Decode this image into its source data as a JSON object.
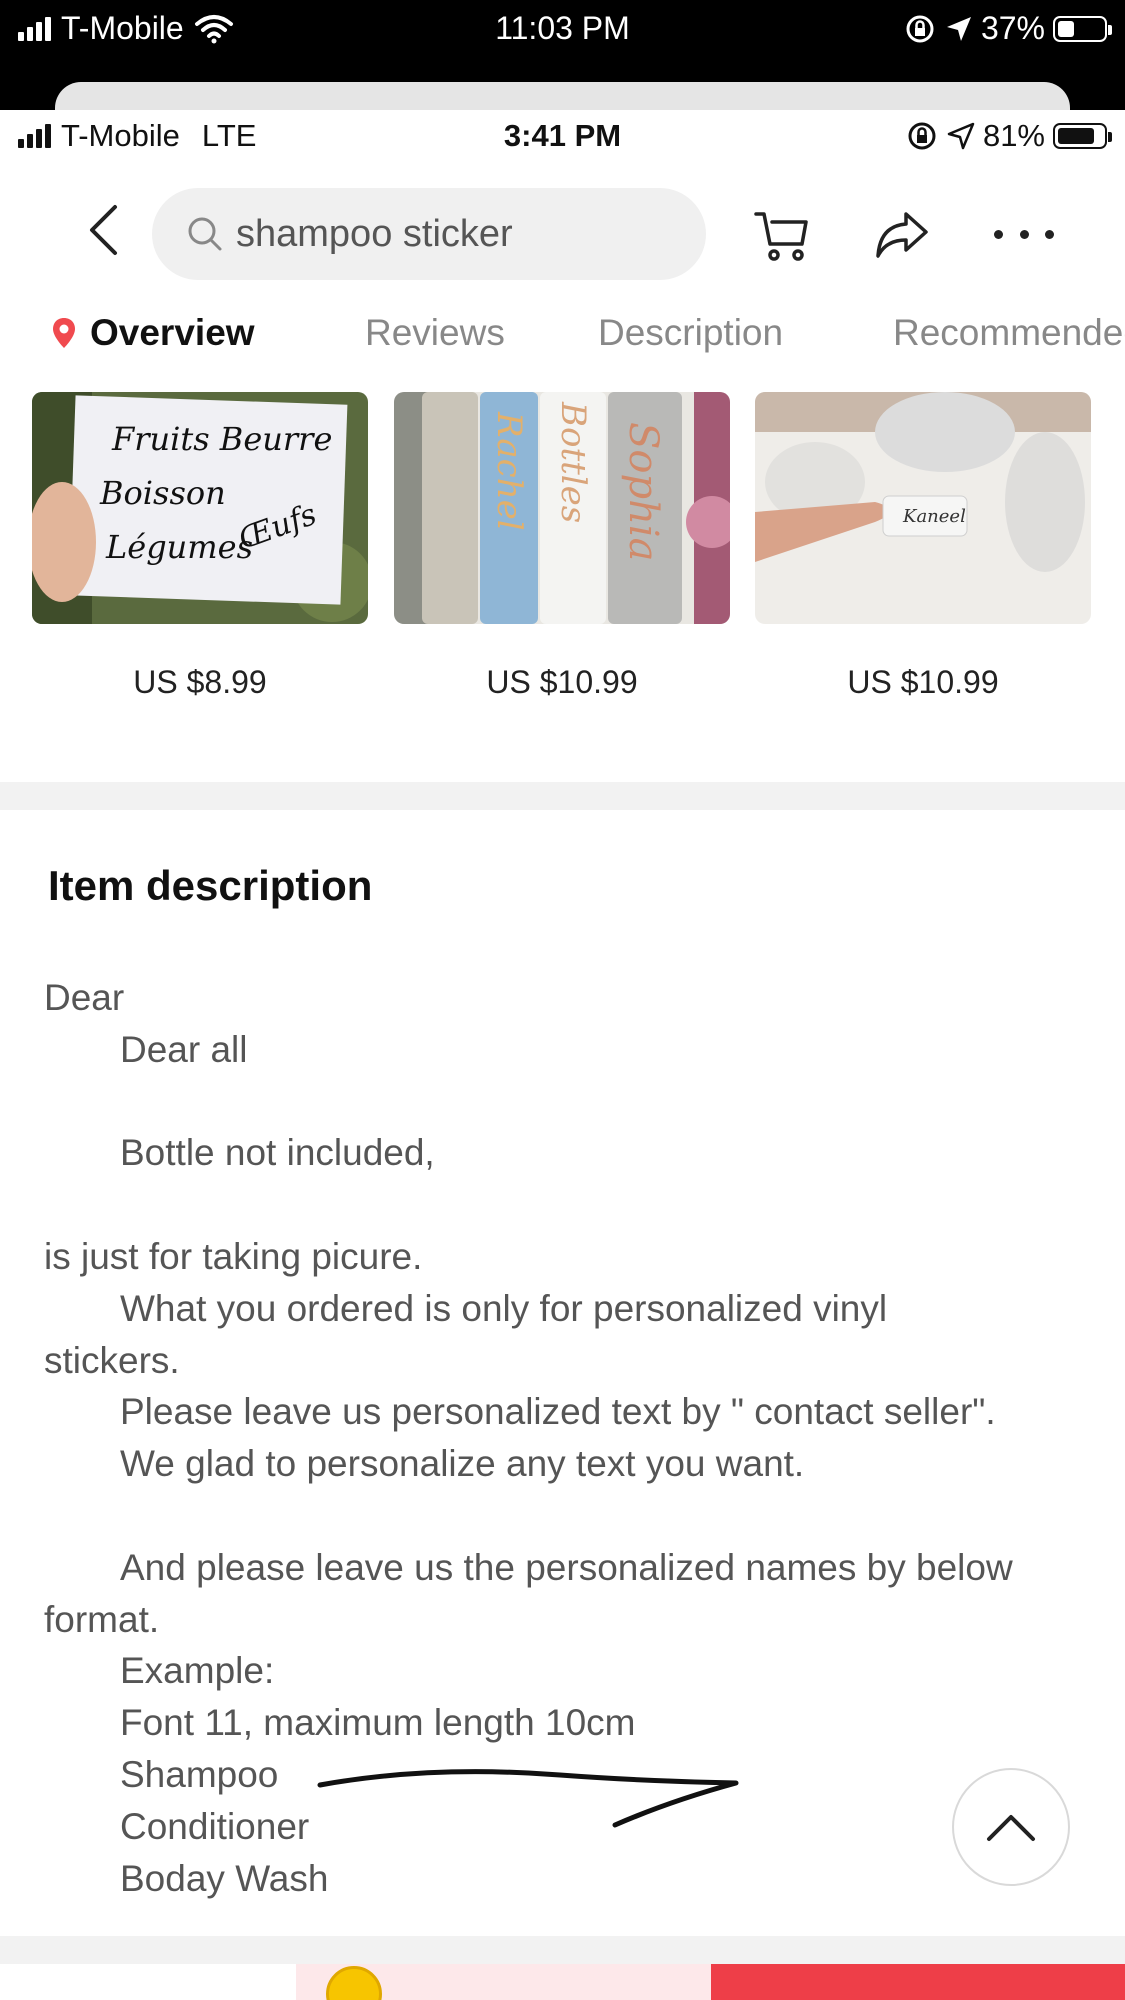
{
  "outer_status": {
    "carrier": "T-Mobile",
    "time": "11:03 PM",
    "battery": "37%",
    "battery_level": 0.37
  },
  "inner_status": {
    "carrier": "T-Mobile",
    "network": "LTE",
    "time": "3:41 PM",
    "battery": "81%",
    "battery_level": 0.81
  },
  "search": {
    "query": "shampoo sticker"
  },
  "tabs": [
    {
      "label": "Overview",
      "active": true
    },
    {
      "label": "Reviews",
      "active": false
    },
    {
      "label": "Description",
      "active": false
    },
    {
      "label": "Recommended",
      "active": false
    }
  ],
  "recommended": [
    {
      "price": "US $8.99",
      "image_text": [
        "Fruits Beurre",
        "Boisson",
        "Légumes",
        "Œufs"
      ]
    },
    {
      "price": "US $10.99",
      "image_text": [
        "Rachel",
        "Bottles",
        "Sophia"
      ]
    },
    {
      "price": "US $10.99",
      "image_text": [
        "Kaneel"
      ]
    }
  ],
  "description": {
    "title": "Item description",
    "lines": [
      {
        "text": "Dear",
        "indent": false
      },
      {
        "text": "Dear all",
        "indent": true
      },
      {
        "text": "",
        "indent": false
      },
      {
        "text": "Bottle not included,",
        "indent": true
      },
      {
        "text": "",
        "indent": false
      },
      {
        "text": "is just for taking picure.",
        "indent": false
      },
      {
        "text": "What you ordered is only for personalized vinyl",
        "indent": true
      },
      {
        "text": "stickers.",
        "indent": false
      },
      {
        "text": "Please leave us personalized text by \" contact seller\".",
        "indent": true
      },
      {
        "text": "We glad to personalize any text you want.",
        "indent": true
      },
      {
        "text": "",
        "indent": false
      },
      {
        "text": "And please leave us the personalized names by below",
        "indent": true
      },
      {
        "text": "format.",
        "indent": false
      },
      {
        "text": "Example:",
        "indent": true
      },
      {
        "text": "Font 11, maximum length 10cm",
        "indent": true
      },
      {
        "text": "Shampoo",
        "indent": true
      },
      {
        "text": "Conditioner",
        "indent": true
      },
      {
        "text": "Boday Wash",
        "indent": true
      }
    ]
  },
  "colors": {
    "accent_red": "#ee3e48",
    "location_pin": "#f04a4f",
    "tab_inactive": "#888888",
    "body_text": "#555555"
  }
}
